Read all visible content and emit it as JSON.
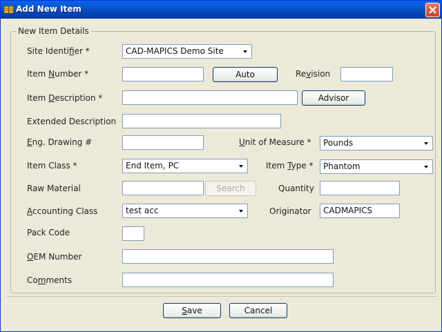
{
  "window": {
    "title": "Add New Item",
    "title_icon": "app-icon",
    "close_icon": "close-icon"
  },
  "group": {
    "legend": "New Item Details"
  },
  "fields": {
    "site_identifier": {
      "label": "Site Identifier *",
      "value": "CAD-MAPICS Demo Site"
    },
    "item_number": {
      "label": "Item Number *",
      "value": "",
      "auto_button": "Auto"
    },
    "revision": {
      "label": "Revision",
      "value": ""
    },
    "item_description": {
      "label": "Item Description *",
      "value": "",
      "advisor_button": "Advisor"
    },
    "extended_description": {
      "label": "Extended Description",
      "value": ""
    },
    "eng_drawing": {
      "label": "Eng. Drawing #",
      "value": ""
    },
    "unit_of_measure": {
      "label": "Unit of Measure *",
      "value": "Pounds"
    },
    "item_class": {
      "label": "Item Class *",
      "value": "End Item, PC"
    },
    "item_type": {
      "label": "Item Type *",
      "value": "Phantom"
    },
    "raw_material": {
      "label": "Raw Material",
      "value": "",
      "search_button": "Search"
    },
    "quantity": {
      "label": "Quantity",
      "value": ""
    },
    "accounting_class": {
      "label": "Accounting Class",
      "value": "test acc"
    },
    "originator": {
      "label": "Originator",
      "value": "CADMAPICS"
    },
    "pack_code": {
      "label": "Pack Code",
      "value": ""
    },
    "oem_number": {
      "label": "OEM Number",
      "value": ""
    },
    "comments": {
      "label": "Comments",
      "value": ""
    }
  },
  "buttons": {
    "save": "Save",
    "cancel": "Cancel"
  }
}
